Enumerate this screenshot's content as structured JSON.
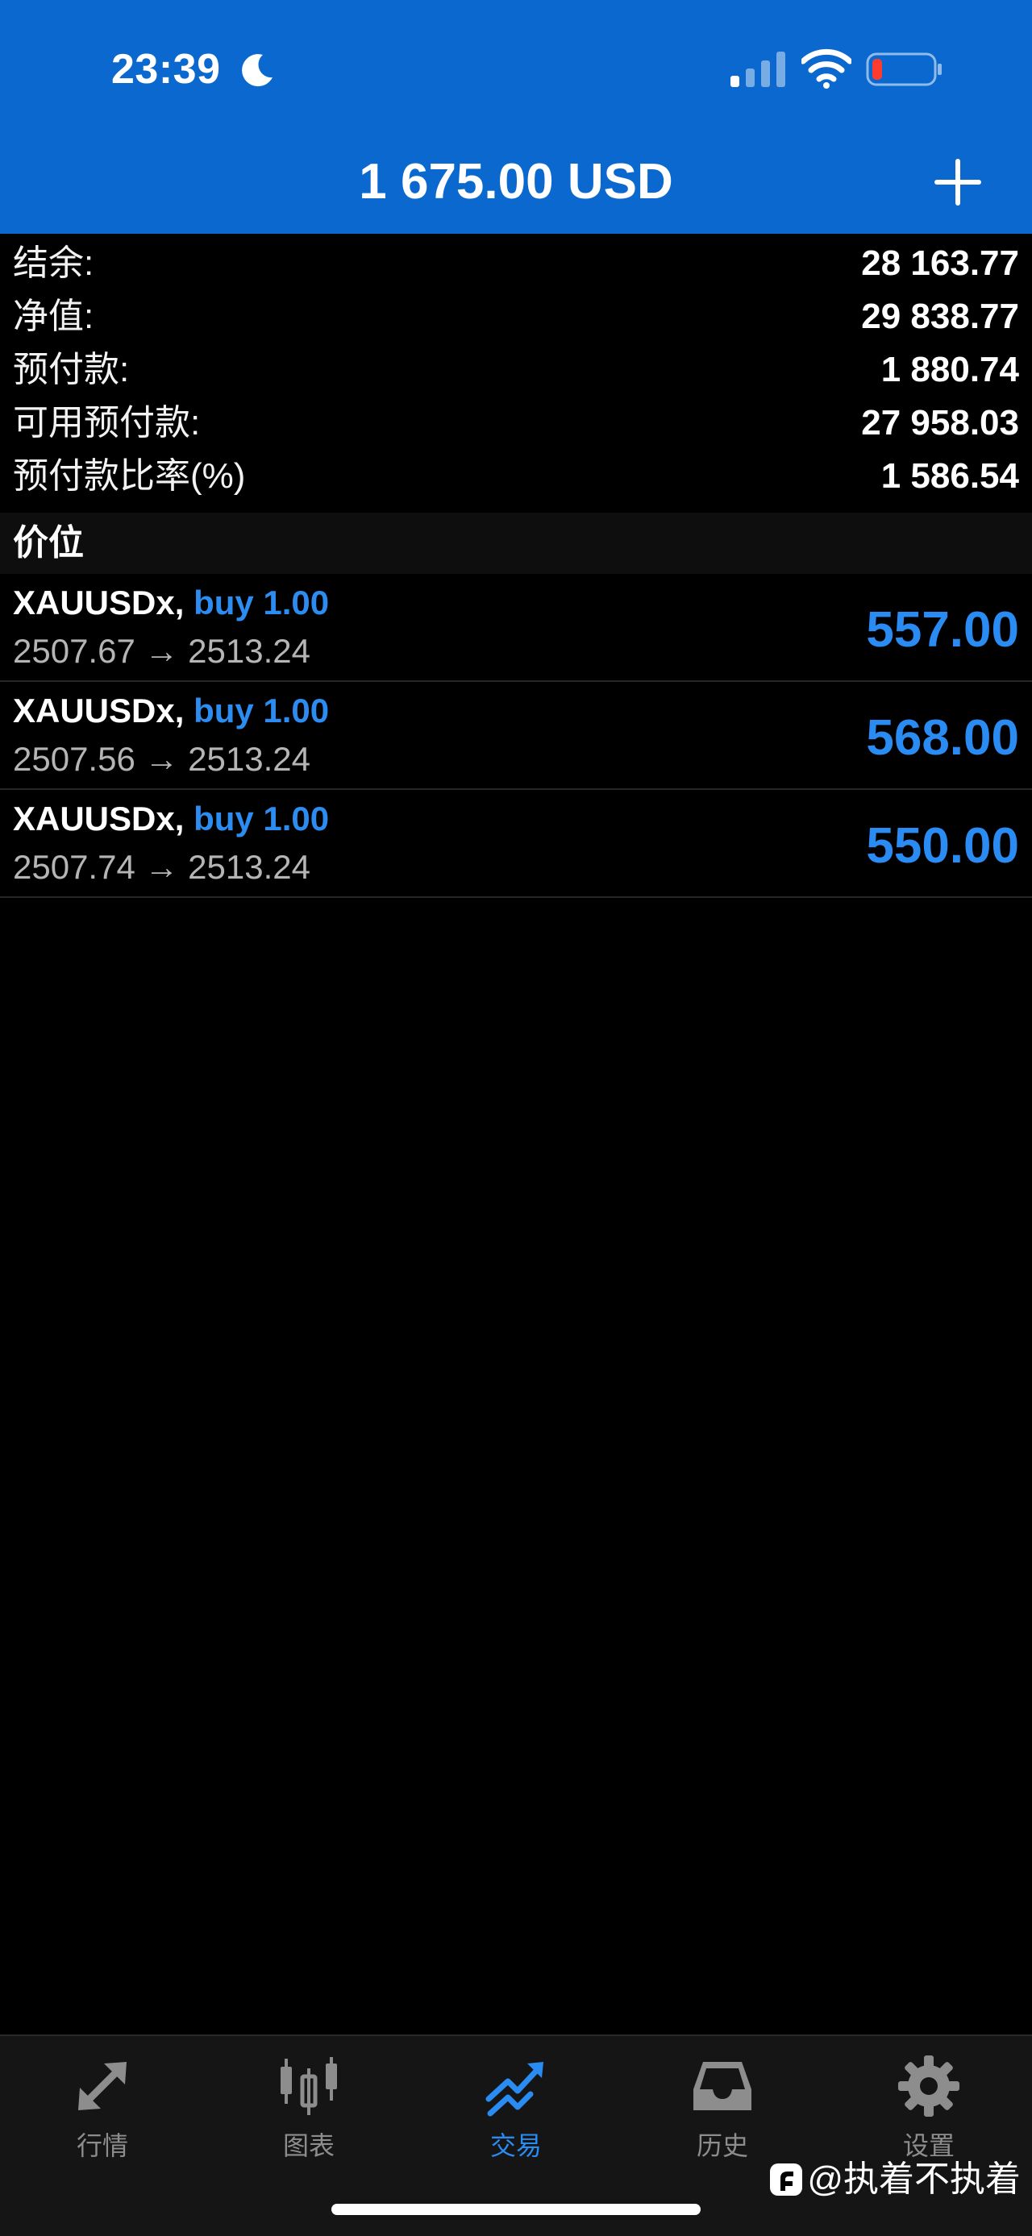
{
  "status_bar": {
    "time": "23:39",
    "icons": [
      "moon-icon",
      "cellular-signal-icon",
      "wifi-icon",
      "battery-icon"
    ]
  },
  "header": {
    "title": "1 675.00 USD",
    "add_icon": "plus-icon"
  },
  "summary": [
    {
      "label": "结余:",
      "value": "28 163.77"
    },
    {
      "label": "净值:",
      "value": "29 838.77"
    },
    {
      "label": "预付款:",
      "value": "1 880.74"
    },
    {
      "label": "可用预付款:",
      "value": "27 958.03"
    },
    {
      "label": "预付款比率(%)",
      "value": "1 586.54"
    }
  ],
  "positions_section": {
    "title": "价位"
  },
  "positions": [
    {
      "symbol": "XAUUSDx,",
      "side": "buy 1.00",
      "prices": "2507.67 → 2513.24",
      "profit": "557.00"
    },
    {
      "symbol": "XAUUSDx,",
      "side": "buy 1.00",
      "prices": "2507.56 → 2513.24",
      "profit": "568.00"
    },
    {
      "symbol": "XAUUSDx,",
      "side": "buy 1.00",
      "prices": "2507.74 → 2513.24",
      "profit": "550.00"
    }
  ],
  "tabs": [
    {
      "label": "行情",
      "icon": "quotes-arrows-icon",
      "active": false
    },
    {
      "label": "图表",
      "icon": "candlestick-chart-icon",
      "active": false
    },
    {
      "label": "交易",
      "icon": "trade-trend-icon",
      "active": true
    },
    {
      "label": "历史",
      "icon": "history-inbox-icon",
      "active": false
    },
    {
      "label": "设置",
      "icon": "settings-gear-icon",
      "active": false
    }
  ],
  "watermark": {
    "text": "@执着不执着"
  },
  "colors": {
    "header_blue": "#0a68cf",
    "accent_blue": "#2a8bf2",
    "background": "#000000",
    "tab_inactive": "#8d8d8d",
    "battery_low": "#ff3b30"
  }
}
